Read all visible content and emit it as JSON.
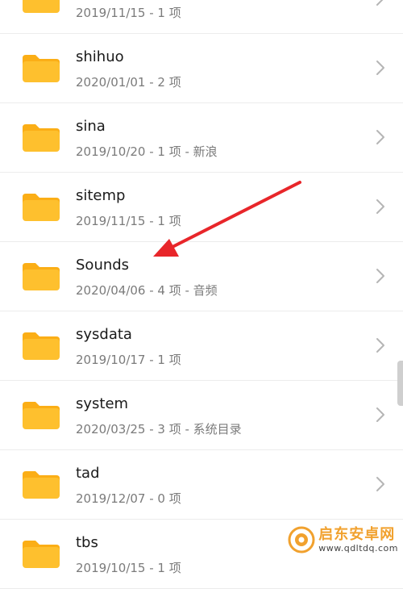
{
  "folders": [
    {
      "name": "",
      "meta": "2019/11/15 - 1 项"
    },
    {
      "name": "shihuo",
      "meta": "2020/01/01 - 2 项"
    },
    {
      "name": "sina",
      "meta": "2019/10/20 - 1 项 - 新浪"
    },
    {
      "name": "sitemp",
      "meta": "2019/11/15 - 1 项"
    },
    {
      "name": "Sounds",
      "meta": "2020/04/06 - 4 项 - 音频"
    },
    {
      "name": "sysdata",
      "meta": "2019/10/17 - 1 项"
    },
    {
      "name": "system",
      "meta": "2020/03/25 - 3 项 - 系统目录"
    },
    {
      "name": "tad",
      "meta": "2019/12/07 - 0 项"
    },
    {
      "name": "tbs",
      "meta": "2019/10/15 - 1 项"
    }
  ],
  "watermark": {
    "title": "启东安卓网",
    "url": "www.qdltdq.com"
  },
  "colors": {
    "folder": "#fec02e",
    "folder_tab": "#fbae16",
    "arrow": "#e8262a",
    "watermark": "#f1a12e"
  }
}
